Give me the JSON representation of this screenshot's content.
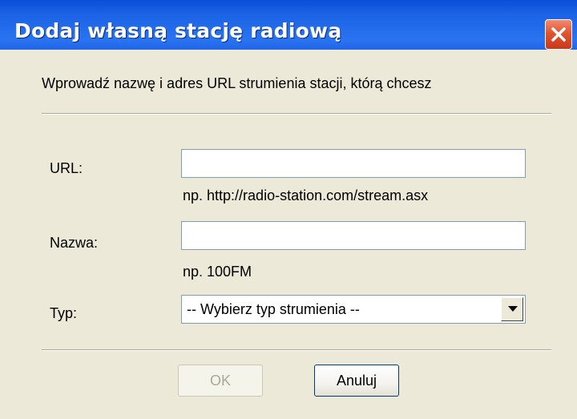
{
  "window": {
    "title": "Dodaj własną stację radiową"
  },
  "intro_text": "Wprowadź nazwę i adres URL strumienia stacji, którą chcesz",
  "url": {
    "label": "URL:",
    "value": "",
    "hint": "np. http://radio-station.com/stream.asx"
  },
  "name": {
    "label": "Nazwa:",
    "value": "",
    "hint": "np. 100FM"
  },
  "type": {
    "label": "Typ:",
    "selected": "-- Wybierz typ strumienia --"
  },
  "buttons": {
    "ok_label": "OK",
    "ok_enabled": false,
    "cancel_label": "Anuluj"
  },
  "colors": {
    "titlebar": "#0a4fd8",
    "close": "#e3532f",
    "dialog_bg": "#ece9d8"
  },
  "icons": {
    "close": "close-icon",
    "dropdown": "chevron-down-icon"
  }
}
